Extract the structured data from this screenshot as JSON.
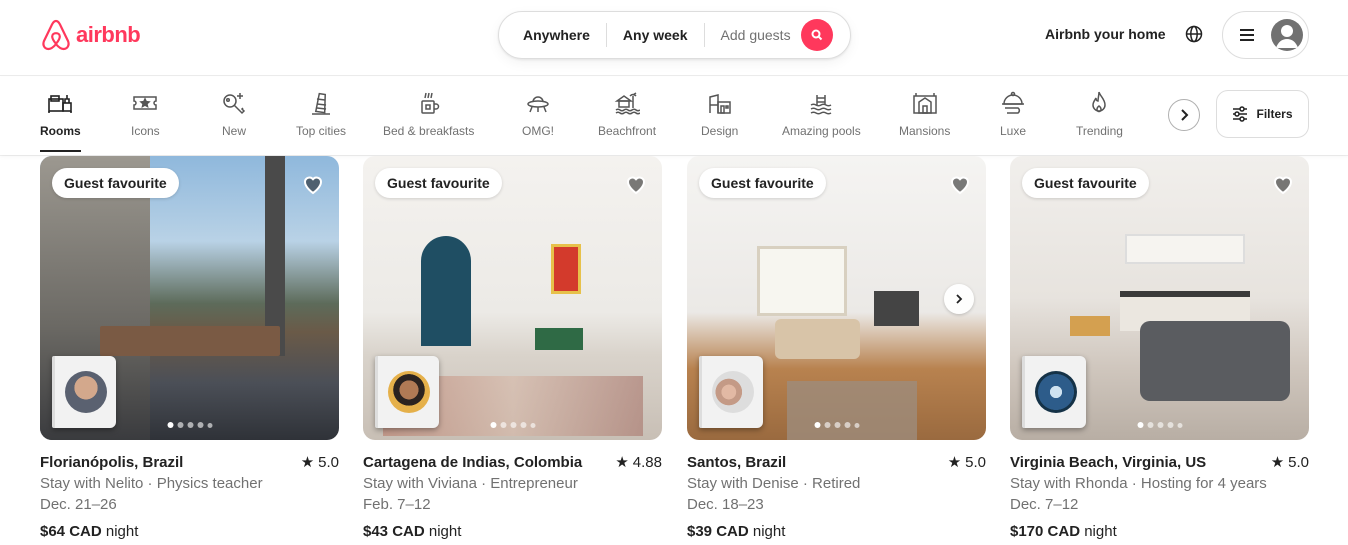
{
  "header": {
    "logo_text": "airbnb",
    "search": {
      "location": "Anywhere",
      "dates": "Any week",
      "guests_placeholder": "Add guests"
    },
    "host_link": "Airbnb your home",
    "brand_color": "#ff385c"
  },
  "categories": {
    "items": [
      {
        "label": "Rooms",
        "icon": "bed-icon",
        "active": true
      },
      {
        "label": "Icons",
        "icon": "ticket-star-icon"
      },
      {
        "label": "New",
        "icon": "key-sparkle-icon"
      },
      {
        "label": "Top cities",
        "icon": "leaning-tower-icon"
      },
      {
        "label": "Bed & breakfasts",
        "icon": "coffee-mug-icon"
      },
      {
        "label": "OMG!",
        "icon": "ufo-icon"
      },
      {
        "label": "Beachfront",
        "icon": "beach-hut-icon"
      },
      {
        "label": "Design",
        "icon": "modern-house-icon"
      },
      {
        "label": "Amazing pools",
        "icon": "pool-icon"
      },
      {
        "label": "Mansions",
        "icon": "mansion-icon"
      },
      {
        "label": "Luxe",
        "icon": "cloche-icon"
      },
      {
        "label": "Trending",
        "icon": "flame-icon"
      }
    ],
    "filters_label": "Filters"
  },
  "listings": [
    {
      "badge": "Guest favourite",
      "title": "Florianópolis, Brazil",
      "rating": "5.0",
      "host_line": "Stay with Nelito · Physics teacher",
      "dates": "Dec. 21–26",
      "price": "$64 CAD",
      "price_unit": "night",
      "photo_count": 5,
      "photo_index": 1
    },
    {
      "badge": "Guest favourite",
      "title": "Cartagena de Indias, Colombia",
      "rating": "4.88",
      "host_line": "Stay with Viviana · Entrepreneur",
      "dates": "Feb. 7–12",
      "price": "$43 CAD",
      "price_unit": "night",
      "photo_count": 5,
      "photo_index": 1
    },
    {
      "badge": "Guest favourite",
      "title": "Santos, Brazil",
      "rating": "5.0",
      "host_line": "Stay with Denise · Retired",
      "dates": "Dec. 18–23",
      "price": "$39 CAD",
      "price_unit": "night",
      "photo_count": 5,
      "photo_index": 1
    },
    {
      "badge": "Guest favourite",
      "title": "Virginia Beach, Virginia, US",
      "rating": "5.0",
      "host_line": "Stay with Rhonda · Hosting for 4 years",
      "dates": "Dec. 7–12",
      "price": "$170 CAD",
      "price_unit": "night",
      "photo_count": 5,
      "photo_index": 1
    }
  ]
}
